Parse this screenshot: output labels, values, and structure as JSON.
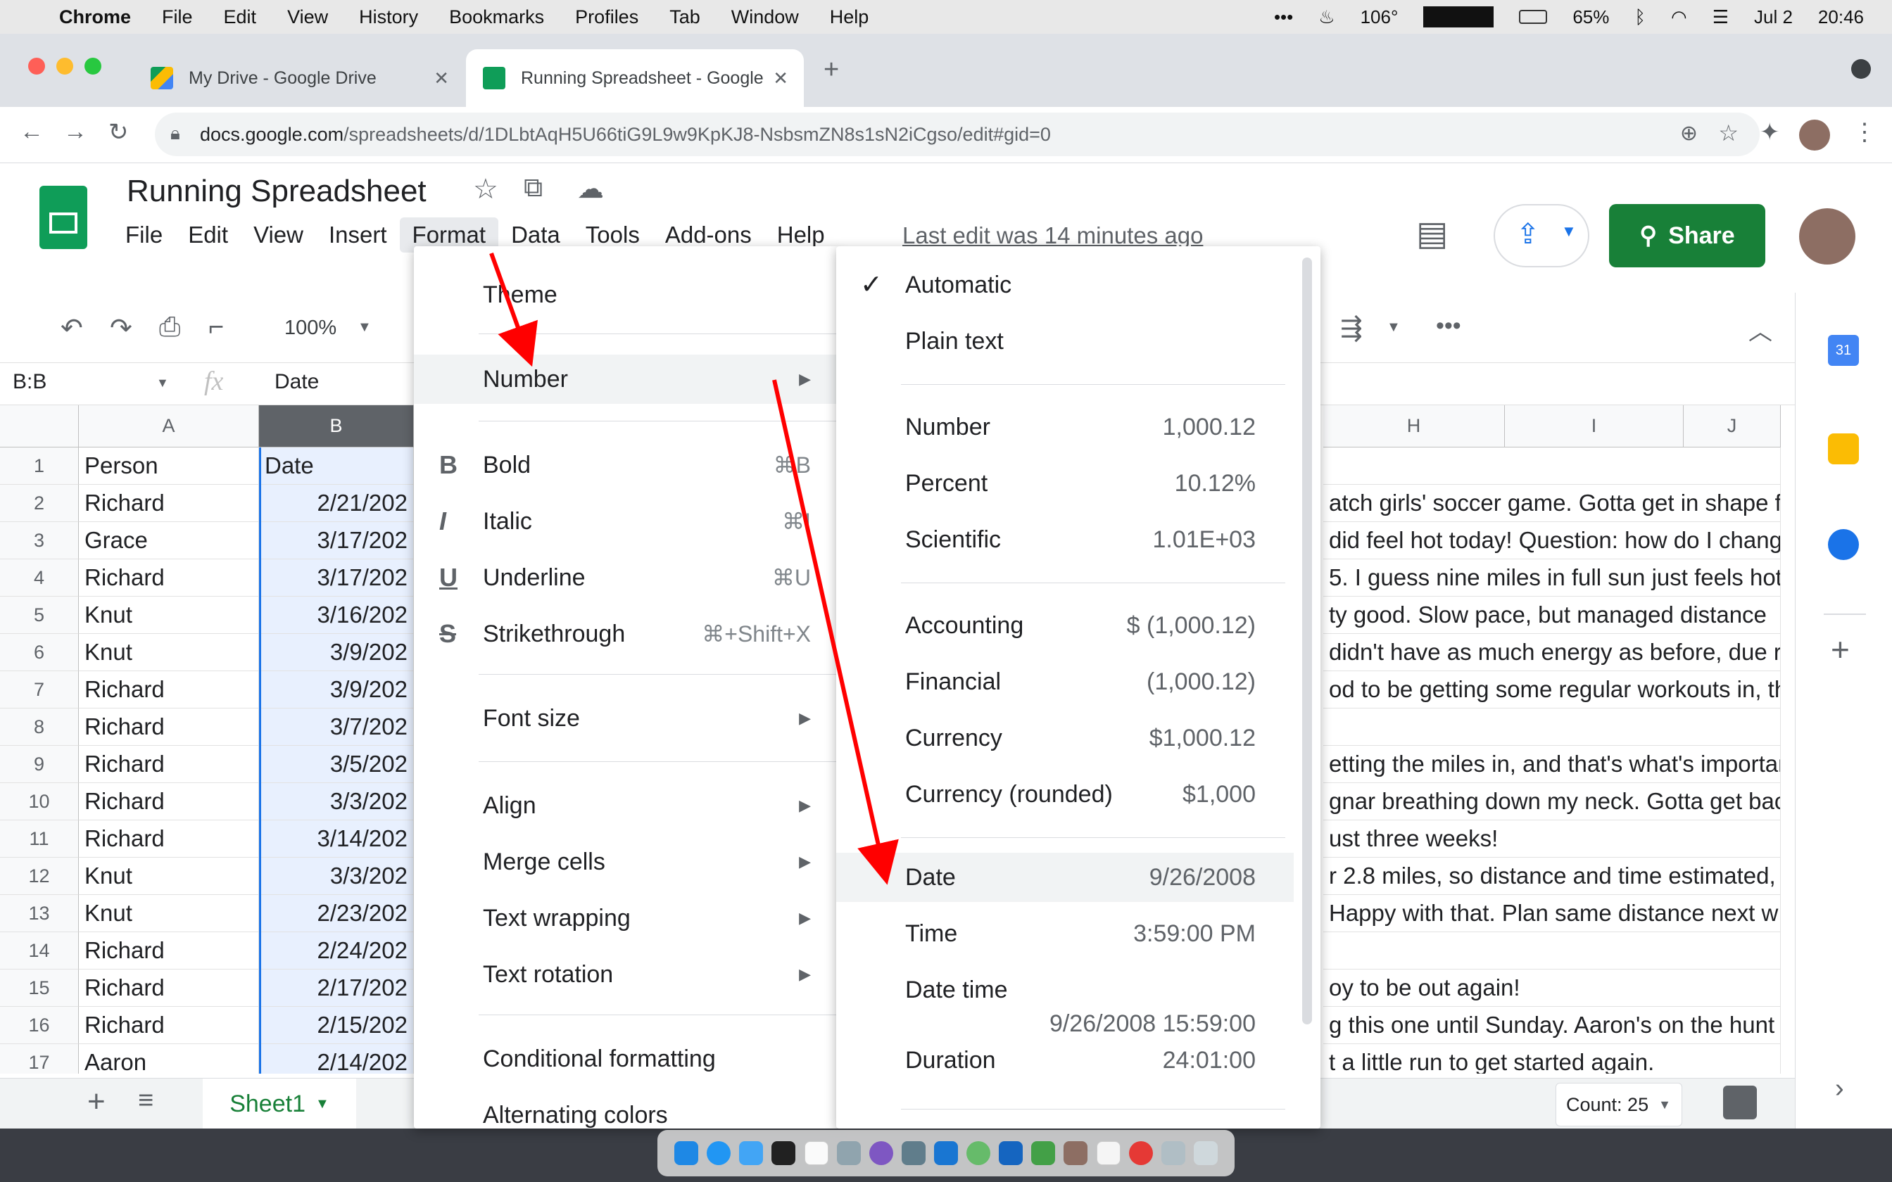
{
  "menubar": {
    "app": "Chrome",
    "items": [
      "File",
      "Edit",
      "View",
      "History",
      "Bookmarks",
      "Profiles",
      "Tab",
      "Window",
      "Help"
    ],
    "status": {
      "temp": "106°",
      "battery": "65%",
      "date": "Jul 2",
      "time": "20:46"
    }
  },
  "tabs": [
    {
      "title": "My Drive - Google Drive"
    },
    {
      "title": "Running Spreadsheet - Google"
    }
  ],
  "address": {
    "host": "docs.google.com",
    "path": "/spreadsheets/d/1DLbtAqH5U66tiG9L9w9KpKJ8-NsbsmZN8s1sN2iCgso/edit#gid=0"
  },
  "doc": {
    "title": "Running Spreadsheet",
    "menus": [
      "File",
      "Edit",
      "View",
      "Insert",
      "Format",
      "Data",
      "Tools",
      "Add-ons",
      "Help"
    ],
    "last_edit": "Last edit was 14 minutes ago",
    "share_label": "Share"
  },
  "toolbar": {
    "zoom": "100%"
  },
  "formula_bar": {
    "name_box": "B:B",
    "fx": "fx",
    "value": "Date"
  },
  "grid": {
    "columns": [
      "A",
      "B",
      "H",
      "I",
      "J"
    ],
    "rows": [
      {
        "n": "1",
        "a": "Person",
        "b": "Date",
        "h": ""
      },
      {
        "n": "2",
        "a": "Richard",
        "b": "2/21/202",
        "h": "atch girls' soccer game. Gotta get in shape f"
      },
      {
        "n": "3",
        "a": "Grace",
        "b": "3/17/202",
        "h": "did feel hot today!  Question: how do I chang"
      },
      {
        "n": "4",
        "a": "Richard",
        "b": "3/17/202",
        "h": "5. I guess nine miles in full sun just feels hot"
      },
      {
        "n": "5",
        "a": "Knut",
        "b": "3/16/202",
        "h": "ty good.  Slow pace, but managed distance"
      },
      {
        "n": "6",
        "a": "Knut",
        "b": "3/9/202",
        "h": "didn't have as much energy as before, due r"
      },
      {
        "n": "7",
        "a": "Richard",
        "b": "3/9/202",
        "h": "od to be getting some regular workouts in, th"
      },
      {
        "n": "8",
        "a": "Richard",
        "b": "3/7/202",
        "h": ""
      },
      {
        "n": "9",
        "a": "Richard",
        "b": "3/5/202",
        "h": "etting the miles in, and that's what's importan"
      },
      {
        "n": "10",
        "a": "Richard",
        "b": "3/3/202",
        "h": "gnar breathing down my neck. Gotta get bac"
      },
      {
        "n": "11",
        "a": "Richard",
        "b": "3/14/202",
        "h": "ust three weeks!"
      },
      {
        "n": "12",
        "a": "Knut",
        "b": "3/3/202",
        "h": "r 2.8 miles, so distance and time estimated,"
      },
      {
        "n": "13",
        "a": "Knut",
        "b": "2/23/202",
        "h": " Happy with that.  Plan same distance next w"
      },
      {
        "n": "14",
        "a": "Richard",
        "b": "2/24/202",
        "h": ""
      },
      {
        "n": "15",
        "a": "Richard",
        "b": "2/17/202",
        "h": "oy to be out again!"
      },
      {
        "n": "16",
        "a": "Richard",
        "b": "2/15/202",
        "h": "g this one until Sunday. Aaron's on the hunt"
      },
      {
        "n": "17",
        "a": "Aaron",
        "b": "2/14/202",
        "h": "t a little run to get started again."
      }
    ]
  },
  "sheetbar": {
    "sheet": "Sheet1",
    "count": "Count: 25"
  },
  "format_menu": {
    "items": [
      {
        "label": "Theme",
        "icon": "",
        "sc": "",
        "arrow": false
      },
      {
        "label": "Number",
        "icon": "",
        "sc": "",
        "arrow": true
      },
      {
        "label": "Bold",
        "icon": "B",
        "sc": "⌘B",
        "arrow": false
      },
      {
        "label": "Italic",
        "icon": "I",
        "sc": "⌘I",
        "arrow": false
      },
      {
        "label": "Underline",
        "icon": "U",
        "sc": "⌘U",
        "arrow": false
      },
      {
        "label": "Strikethrough",
        "icon": "S",
        "sc": "⌘+Shift+X",
        "arrow": false
      },
      {
        "label": "Font size",
        "icon": "",
        "sc": "",
        "arrow": true
      },
      {
        "label": "Align",
        "icon": "",
        "sc": "",
        "arrow": true
      },
      {
        "label": "Merge cells",
        "icon": "",
        "sc": "",
        "arrow": true
      },
      {
        "label": "Text wrapping",
        "icon": "",
        "sc": "",
        "arrow": true
      },
      {
        "label": "Text rotation",
        "icon": "",
        "sc": "",
        "arrow": true
      },
      {
        "label": "Conditional formatting",
        "icon": "",
        "sc": "",
        "arrow": false
      },
      {
        "label": "Alternating colors",
        "icon": "",
        "sc": "",
        "arrow": false
      }
    ]
  },
  "number_menu": {
    "items": [
      {
        "label": "Automatic",
        "ex": "",
        "checked": true
      },
      {
        "label": "Plain text",
        "ex": ""
      },
      {
        "label": "Number",
        "ex": "1,000.12"
      },
      {
        "label": "Percent",
        "ex": "10.12%"
      },
      {
        "label": "Scientific",
        "ex": "1.01E+03"
      },
      {
        "label": "Accounting",
        "ex": "$ (1,000.12)"
      },
      {
        "label": "Financial",
        "ex": "(1,000.12)"
      },
      {
        "label": "Currency",
        "ex": "$1,000.12"
      },
      {
        "label": "Currency (rounded)",
        "ex": "$1,000"
      },
      {
        "label": "Date",
        "ex": "9/26/2008"
      },
      {
        "label": "Time",
        "ex": "3:59:00 PM"
      },
      {
        "label": "Date time",
        "ex": "9/26/2008 15:59:00"
      },
      {
        "label": "Duration",
        "ex": "24:01:00"
      }
    ]
  },
  "colors": {
    "accent_green": "#188038",
    "arrow_red": "#ff0000",
    "selection": "#e8f0fe"
  }
}
